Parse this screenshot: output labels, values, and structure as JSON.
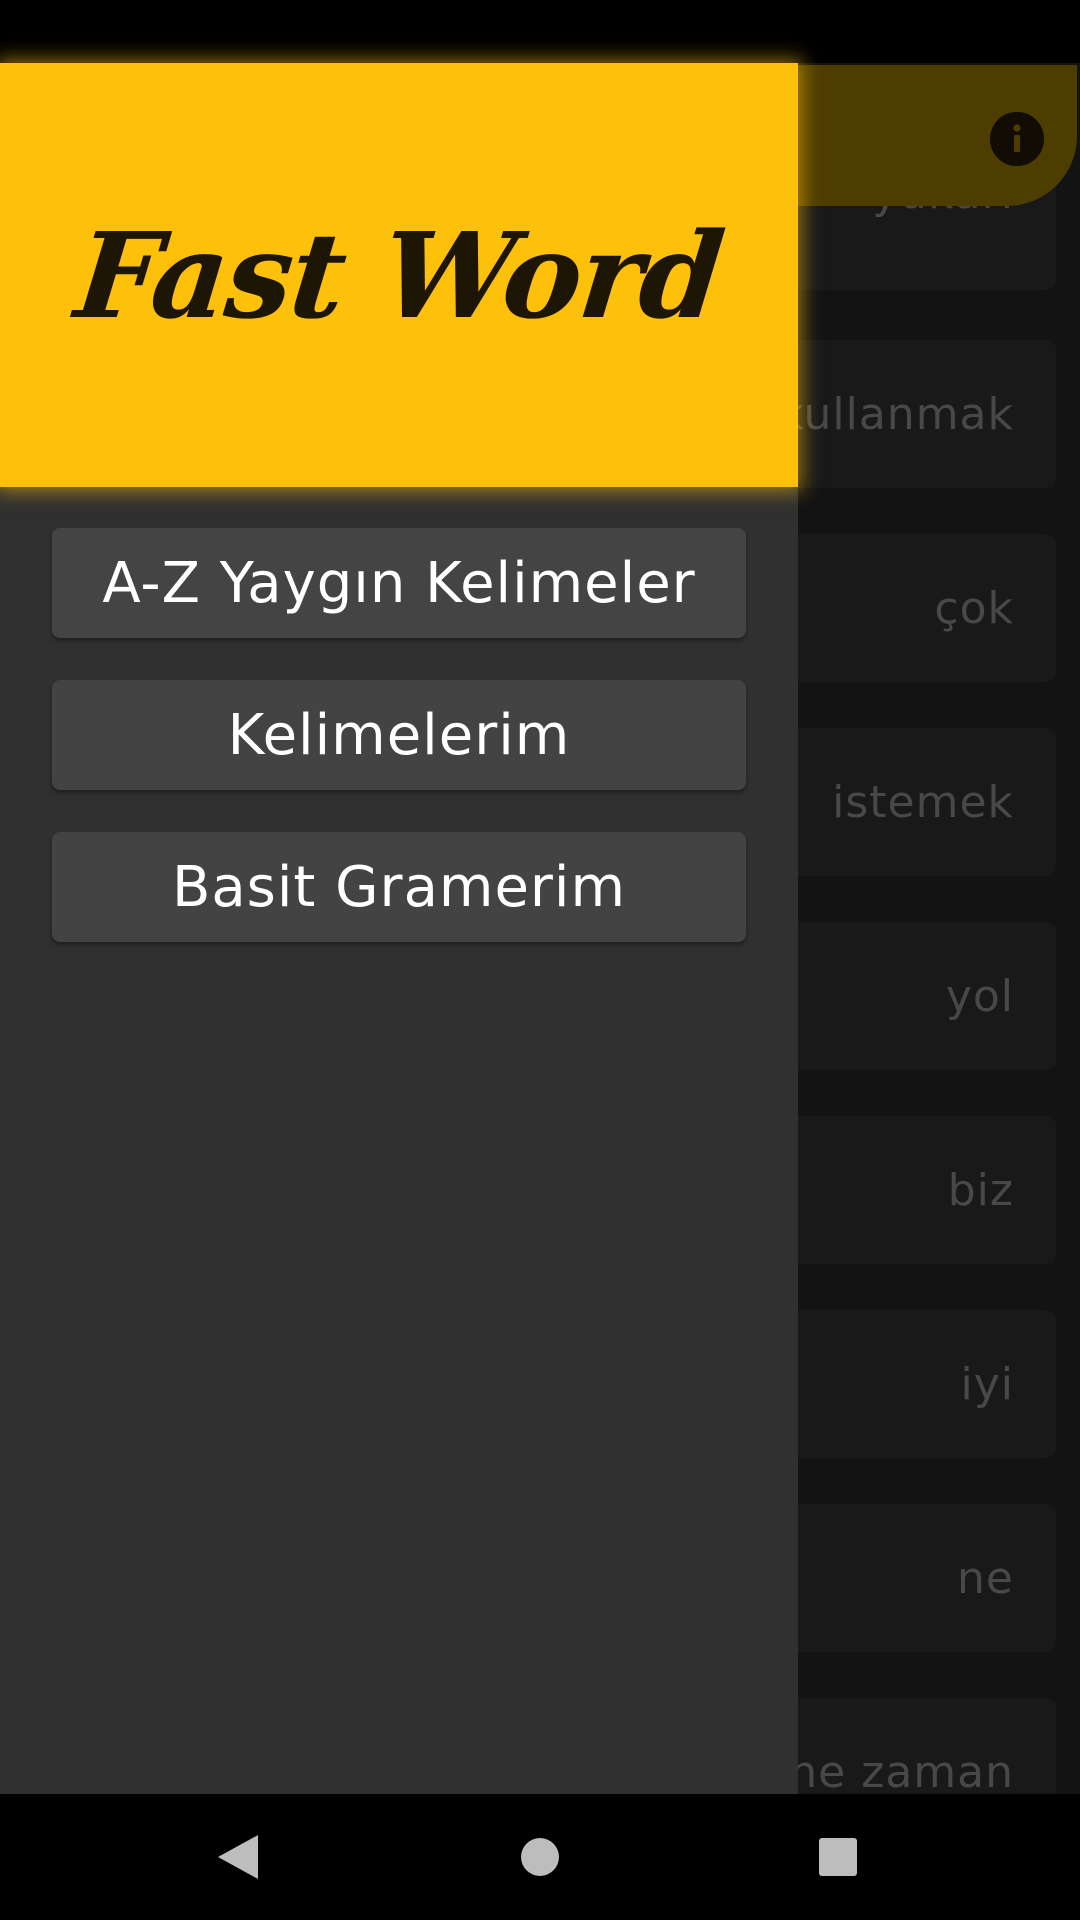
{
  "app_bar": {
    "info_icon": "info-icon",
    "color": "#745b00"
  },
  "word_list": [
    "yukarı",
    "kullanmak",
    "çok",
    "istemek",
    "yol",
    "biz",
    "iyi",
    "ne",
    "ne zaman"
  ],
  "drawer": {
    "title": "Fast Word",
    "header_color": "#fec10b",
    "menu_items": [
      {
        "label": "A-Z Yaygın Kelimeler"
      },
      {
        "label": "Kelimelerim"
      },
      {
        "label": "Basit Gramerim"
      }
    ]
  },
  "nav_bar": {
    "back_icon": "back-triangle-icon",
    "home_icon": "home-circle-icon",
    "recents_icon": "recents-square-icon"
  }
}
